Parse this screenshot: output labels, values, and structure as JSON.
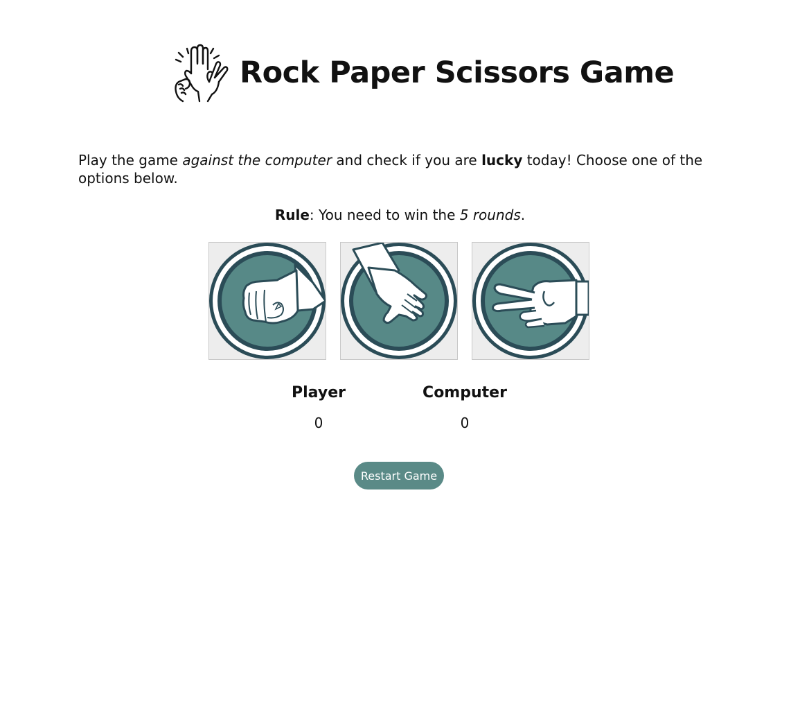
{
  "header": {
    "title": "Rock Paper Scissors Game",
    "logo_icon": "hands-gesture-icon"
  },
  "intro": {
    "part1": "Play the game ",
    "emphasis": "against the computer",
    "part2": " and check if you are ",
    "strong": "lucky",
    "part3": " today! Choose one of the options below."
  },
  "rule": {
    "label": "Rule",
    "text": ": You need to win the ",
    "emphasis": "5 rounds",
    "end": "."
  },
  "choices": [
    {
      "name": "rock",
      "icon": "rock-fist-icon"
    },
    {
      "name": "paper",
      "icon": "paper-hand-icon"
    },
    {
      "name": "scissors",
      "icon": "scissors-hand-icon"
    }
  ],
  "scoreboard": {
    "player_label": "Player",
    "player_score": "0",
    "computer_label": "Computer",
    "computer_score": "0"
  },
  "restart_label": "Restart Game",
  "colors": {
    "accent": "#5a8a87",
    "ring_dark": "#2b4c57",
    "tile_bg": "#ededed"
  }
}
